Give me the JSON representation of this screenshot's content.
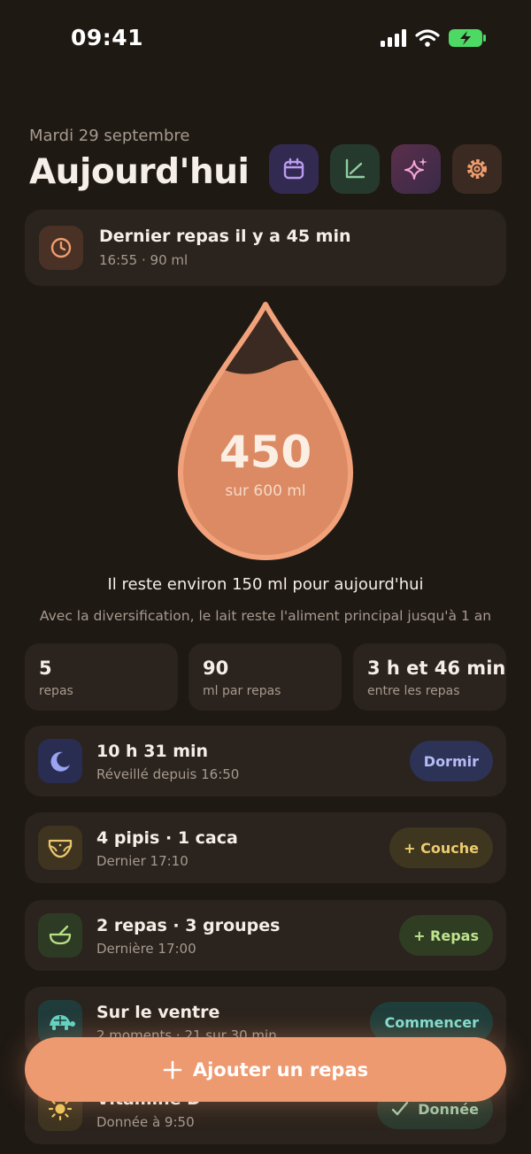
{
  "status_bar": {
    "time": "09:41"
  },
  "header": {
    "date": "Mardi 29 septembre",
    "title": "Aujourd'hui"
  },
  "top_buttons": [
    {
      "icon": "calendar-icon",
      "bg": "#332a52",
      "fg": "#b99cf0"
    },
    {
      "icon": "chart-icon",
      "bg": "#25392d",
      "fg": "#8fcfa4"
    },
    {
      "icon": "sparkles-icon",
      "bg": "#4a2c40",
      "fg": "#f3a6d9"
    },
    {
      "icon": "gear-icon",
      "bg": "#3a2a22",
      "fg": "#ef9d6f"
    }
  ],
  "last_meal": {
    "title": "Dernier repas il y a 45 min",
    "subtitle": "16:55 · 90 ml"
  },
  "drop": {
    "value": "450",
    "subtitle": "sur 600 ml",
    "fill_fraction": 0.75
  },
  "remaining_text": "Il reste environ 150 ml pour aujourd'hui",
  "hint_text": "Avec la diversification, le lait reste l'aliment principal jusqu'à 1 an",
  "stats": [
    {
      "value": "5",
      "label": "repas"
    },
    {
      "value": "90",
      "label": "ml par repas"
    },
    {
      "value": "3 h et 46 min",
      "label": "entre les repas"
    }
  ],
  "rows": {
    "sleep": {
      "title": "10 h 31 min",
      "subtitle": "Réveillé depuis 16:50",
      "button": "Dormir"
    },
    "diaper": {
      "title": "4 pipis · 1 caca",
      "subtitle": "Dernier 17:10",
      "button": "+ Couche"
    },
    "meals": {
      "title": "2 repas · 3 groupes",
      "subtitle": "Dernière 17:00",
      "button": "+ Repas"
    },
    "tummy": {
      "title": "Sur le ventre",
      "subtitle": "2 moments · 21 sur 30 min",
      "button": "Commencer"
    },
    "vitamin": {
      "title": "Vitamine D",
      "subtitle": "Donnée à 9:50",
      "button": "Donnée"
    }
  },
  "cta": {
    "label": "Ajouter un repas"
  },
  "colors": {
    "background": "#1f1914",
    "card": "#2b231d",
    "accent": "#ee9a70"
  }
}
